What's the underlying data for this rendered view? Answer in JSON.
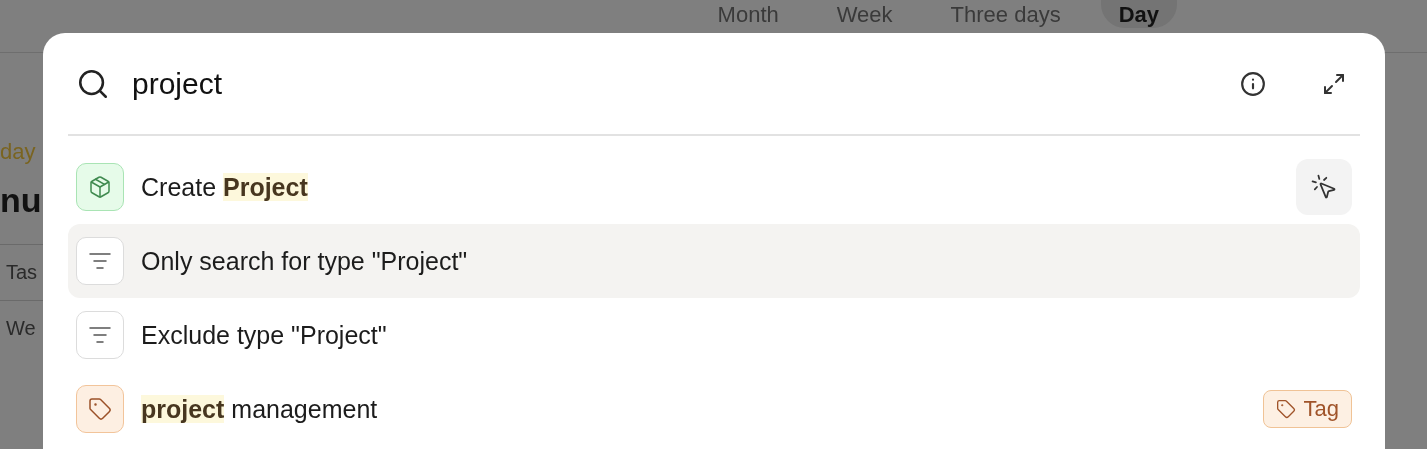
{
  "background": {
    "view_tabs": [
      {
        "label": "Month",
        "selected": false
      },
      {
        "label": "Week",
        "selected": false
      },
      {
        "label": "Three days",
        "selected": false
      },
      {
        "label": "Day",
        "selected": true
      }
    ],
    "date_label": "day",
    "heading": "nu",
    "table_cells": [
      "Tas",
      "We"
    ]
  },
  "palette": {
    "query": "project",
    "results": [
      {
        "kind": "create",
        "label": "Create **Project**",
        "selected": false,
        "action": true
      },
      {
        "kind": "filter",
        "label": "Only search for type \"Project\"",
        "selected": true
      },
      {
        "kind": "exclude",
        "label": "Exclude type \"Project\"",
        "selected": false
      },
      {
        "kind": "tag",
        "label": "**project** management",
        "selected": false,
        "badge": "Tag"
      }
    ]
  }
}
